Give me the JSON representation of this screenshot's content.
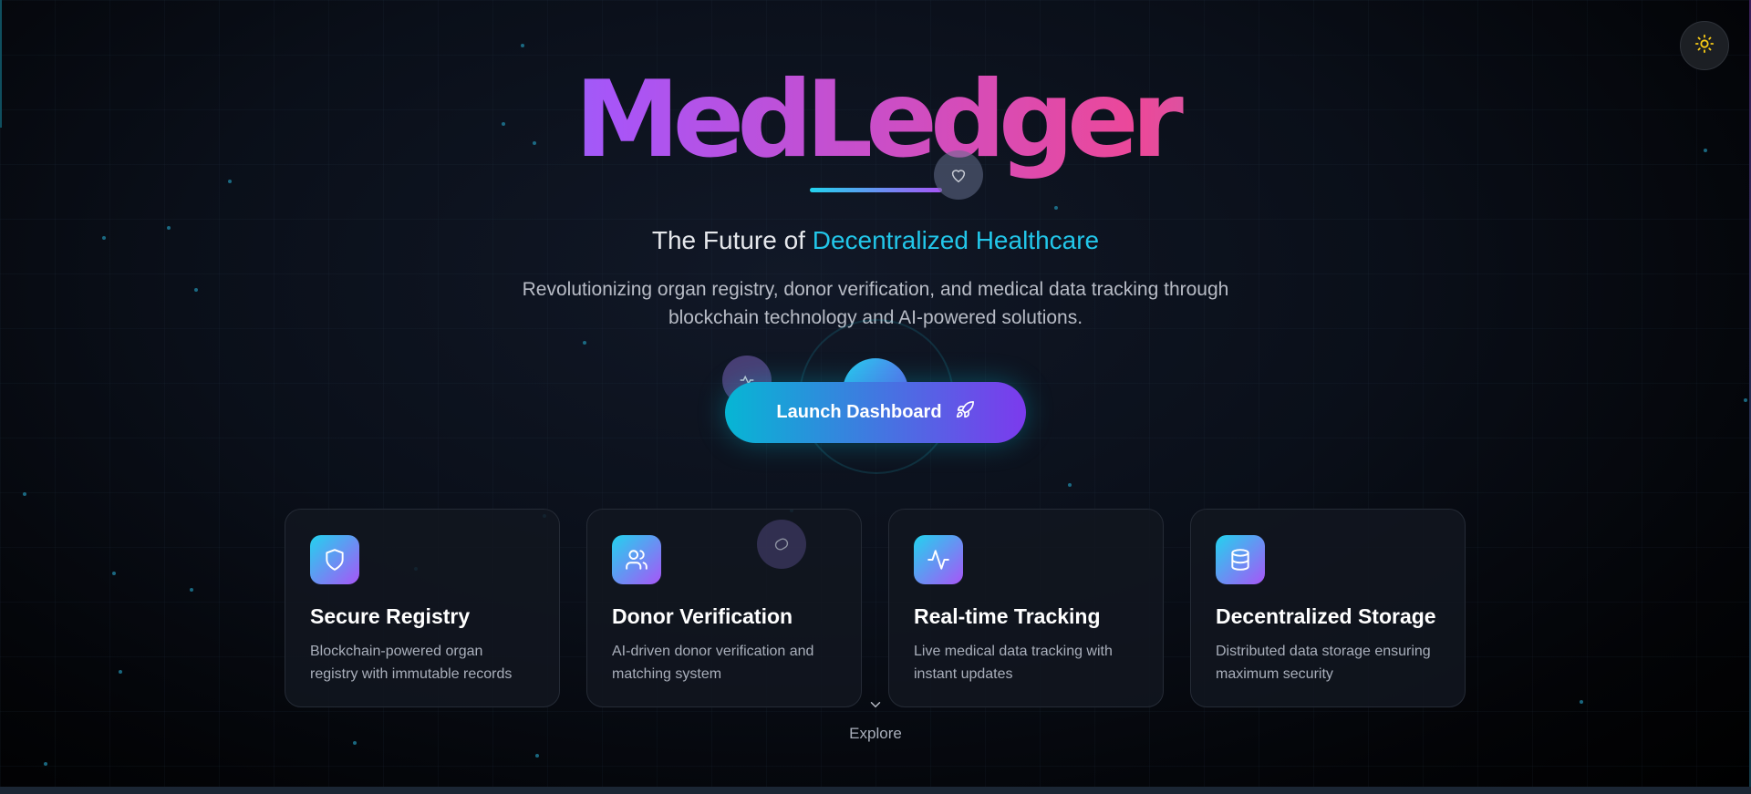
{
  "theme_toggle": {
    "icon": "sun-icon",
    "color": "#facc15"
  },
  "hero": {
    "logo": "MedLedger",
    "tagline_prefix": "The Future of ",
    "tagline_accent": "Decentralized Healthcare",
    "description": "Revolutionizing organ registry, donor verification, and medical data tracking through blockchain technology and AI-powered solutions.",
    "cta_label": "Launch Dashboard",
    "cta_icon": "rocket-icon"
  },
  "features": [
    {
      "icon": "shield-icon",
      "title": "Secure Registry",
      "text": "Blockchain-powered organ registry with immutable records"
    },
    {
      "icon": "users-icon",
      "title": "Donor Verification",
      "text": "AI-driven donor verification and matching system"
    },
    {
      "icon": "activity-icon",
      "title": "Real-time Tracking",
      "text": "Live medical data tracking with instant updates"
    },
    {
      "icon": "database-icon",
      "title": "Decentralized Storage",
      "text": "Distributed data storage ensuring maximum security"
    }
  ],
  "explore": {
    "label": "Explore",
    "icon": "chevron-down-icon"
  },
  "colors": {
    "accent_cyan": "#22c6e9",
    "accent_purple": "#a855f7",
    "accent_pink": "#ec4899"
  }
}
